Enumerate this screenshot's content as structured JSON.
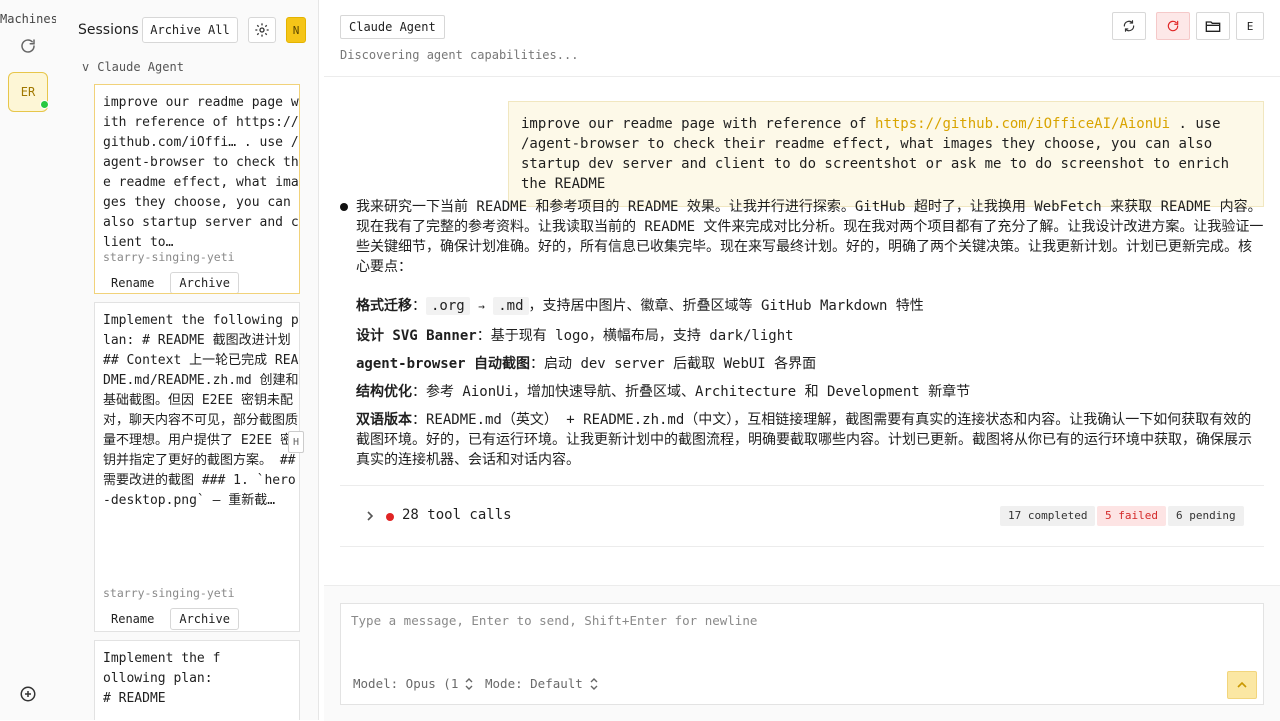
{
  "rail": {
    "title": "Machines",
    "avatar_initials": "ER",
    "status_color": "#28c840"
  },
  "sessions": {
    "title": "Sessions",
    "archive_all_label": "Archive All",
    "new_label": "N",
    "group_chevron": "v",
    "group_name": "Claude Agent",
    "side_chip": "H",
    "items": [
      {
        "text": "improve our readme page with reference of https://github.com/iOffi… . use /agent-browser to check the readme effect, what images they choose, you can also startup server and client to…",
        "machine": "starry-singing-yeti",
        "rename_label": "Rename",
        "archive_label": "Archive"
      },
      {
        "text": "Implement the following plan: # README 截图改进计划 ## Context 上一轮已完成 README.md/README.zh.md 创建和基础截图。但因 E2EE 密钥未配对，聊天内容不可见，部分截图质量不理想。用户提供了 E2EE 密钥并指定了更好的截图方案。 ## 需要改进的截图 ### 1. `hero-desktop.png` — 重新截…",
        "machine": "starry-singing-yeti",
        "rename_label": "Rename",
        "archive_label": "Archive"
      },
      {
        "text": "Implement the following plan: # README",
        "machine": "",
        "rename_label": "",
        "archive_label": ""
      }
    ]
  },
  "main": {
    "agent_tag": "Claude Agent",
    "status": "Discovering agent capabilities...",
    "header_icon_4": "E",
    "user_message": {
      "before": "improve our readme page with reference of ",
      "link": "https://github.com/iOfficeAI/AionUi",
      "after": " . use /agent-browser to check their readme effect, what images they choose, you can also startup dev server and client to do screentshot or ask me to do screenshot to enrich the README"
    },
    "assistant_para": "我来研究一下当前 README 和参考项目的 README 效果。让我并行进行探索。GitHub 超时了，让我换用 WebFetch 来获取 README 内容。现在我有了完整的参考资料。让我读取当前的 README 文件来完成对比分析。现在我对两个项目都有了充分了解。让我设计改进方案。让我验证一些关键细节，确保计划准确。好的，所有信息已收集完毕。现在来写最终计划。好的，明确了两个关键决策。让我更新计划。计划已更新完成。核心要点：",
    "points": {
      "p1_key": "格式迁移",
      "p1_colon": "：",
      "p1_code1": ".org",
      "p1_arrow": "→",
      "p1_code2": ".md",
      "p1_rest": "，支持居中图片、徽章、折叠区域等 GitHub Markdown 特性",
      "p2_key": "设计 SVG Banner",
      "p2_rest": "：基于现有 logo，横幅布局，支持 dark/light",
      "p3_key": "agent-browser 自动截图",
      "p3_rest": "：启动 dev server 后截取 WebUI 各界面",
      "p4_key": "结构优化",
      "p4_rest": "：参考 AionUi，增加快速导航、折叠区域、Architecture 和 Development 新章节",
      "p5_key": "双语版本",
      "p5_rest": "：README.md（英文） + README.zh.md（中文），互相链接理解，截图需要有真实的连接状态和内容。让我确认一下如何获取有效的截图环境。好的，已有运行环境。让我更新计划中的截图流程，明确要截取哪些内容。计划已更新。截图将从你已有的运行环境中获取，确保展示真实的连接机器、会话和对话内容。"
    },
    "tools": {
      "count_label": "28 tool calls",
      "completed": "17 completed",
      "failed": "5 failed",
      "pending": "6 pending"
    },
    "composer": {
      "placeholder": "Type a message, Enter to send, Shift+Enter for newline",
      "model_label": "Model: Opus (1",
      "mode_label": "Mode: Default"
    }
  },
  "colors": {
    "accent": "#f5c518",
    "failed": "#e02424",
    "link": "#d9a400"
  }
}
